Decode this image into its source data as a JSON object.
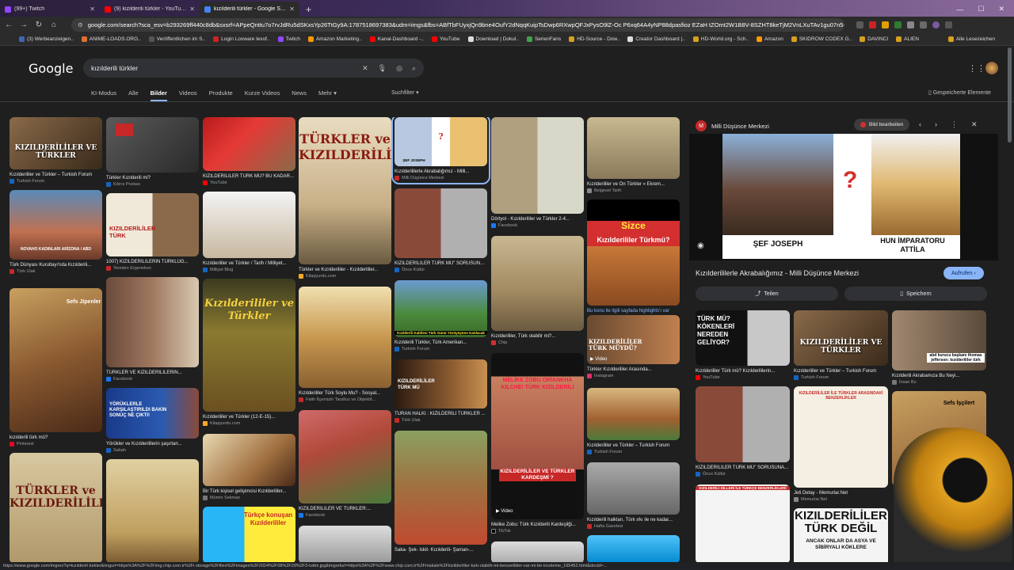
{
  "tabs": [
    {
      "label": "(99+) Twitch",
      "color": "#9146ff"
    },
    {
      "label": "(9) kizilderili türkler - YouTube",
      "color": "#ff0000"
    },
    {
      "label": "kızılderili türkler - Google Suche",
      "color": "#4285f4"
    }
  ],
  "address": {
    "url": "google.com/search?sca_esv=b293269ff440c8db&sxsrf=APpeQnttu7o7rvJdRu5dSKxsYp26TtGy9A:1787518697383&udm=imgs&fbs=ABfTbFUyxjQn9bne4OufY2dNqqKuipTsDwp6RXwpQFJxPysO9lZ-Oc P6xq64A4yNP88dpasfioz EZaH tZOmt2W1B8V-8SZHT8keTjM2VnLXuTAv1gu07n5--r-F3GvcuxgU2wNBbK..."
  },
  "bookmarks": [
    {
      "label": "(3) Werbeanzeigen..",
      "color": "#4267b2"
    },
    {
      "label": "ANIME-LOADS.ORG..",
      "color": "#e07030"
    },
    {
      "label": "Veröffentlichen im S..",
      "color": "#555555"
    },
    {
      "label": "Login Loxware lexof..",
      "color": "#cc2222"
    },
    {
      "label": "Twitch",
      "color": "#9146ff"
    },
    {
      "label": "Amazon Marketing..",
      "color": "#ff9900"
    },
    {
      "label": "Kanal-Dashboard -..",
      "color": "#ff0000"
    },
    {
      "label": "YouTube",
      "color": "#ff0000"
    },
    {
      "label": "Download | Dokul..",
      "color": "#dddddd"
    },
    {
      "label": "SerienFans",
      "color": "#3fa34d"
    },
    {
      "label": "HD-Source - Dow..",
      "color": "#d8a020"
    },
    {
      "label": "Creator Dashboard |..",
      "color": "#dddddd"
    },
    {
      "label": "HD-World.org - Sch..",
      "color": "#d8a020"
    },
    {
      "label": "Amazon",
      "color": "#ff9900"
    },
    {
      "label": "SKIDROW CODEX G..",
      "color": "#d8a020"
    },
    {
      "label": "DAVINCI",
      "color": "#d8a020"
    },
    {
      "label": "ALIEN",
      "color": "#d8a020"
    }
  ],
  "all_bookmarks": "Alle Lesezeichen",
  "google": {
    "logo": "Google",
    "query": "kızılderili türkler",
    "tabs": [
      "KI-Modus",
      "Alle",
      "Bilder",
      "Videos",
      "Produkte",
      "Kurze Videos",
      "News",
      "Mehr ▾"
    ],
    "active_tab": "Bilder",
    "tools": "Suchfilter ▾",
    "saved": "Gespeicherte Elemente"
  },
  "results": {
    "col1": [
      {
        "caption": "Kızılderililer ve Türkler – Turkish Forum",
        "source": "Turkish Forum",
        "overlay": "KIZILDERİLİLER VE TÜRKLER"
      },
      {
        "caption": "Türk Dünyası Kurultayı'nda Kızılderili...",
        "source": "Türk Ulak",
        "overlay": "NOVAHO KADINLARI ARİZONA / ABD"
      },
      {
        "caption": "kızılderili türk mü?",
        "source": "Pinterest",
        "overlay": "Sefs Jipenler"
      },
      {
        "caption": "",
        "source": "",
        "overlay": "TÜRKLER ve KIZILDERİLİLER"
      }
    ],
    "col2": [
      {
        "caption": "Türkler Kızılderili mi?",
        "source": "Kıbrıs Postası"
      },
      {
        "caption": "1007) KIZILDERİLİLERİN TÜRKLÜĞ...",
        "source": "Yeniden Ergenekon",
        "overlay": "KIZILDERİLİLER TÜRK"
      },
      {
        "caption": "TÜRKLER VE KIZILDERİLİLERİN...",
        "source": "Facebook"
      },
      {
        "caption": "Yörükler ve Kızılderililerin şaşırtan...",
        "source": "Sabah",
        "overlay": "YÖRÜKLERLE KARŞILAŞTIRILDI BAKIN SONUÇ NE ÇIKTI!"
      },
      {
        "caption": "",
        "source": ""
      }
    ],
    "col3": [
      {
        "caption": "KIZILDERİLİLER TÜRK MÜ? BU KADAR...",
        "source": "YouTube"
      },
      {
        "caption": "Kızılderililer ve Türkler / Tarih / Milliyet...",
        "source": "Milliyet Blog"
      },
      {
        "caption": "Kızılderililer ve Türkler (12-E-15)...",
        "source": "Kitapyurdu.com",
        "overlay": "Kızılderililer ve Türkler"
      },
      {
        "caption": "Bir Türk kişisel gelişimcisi Kızılderililer...",
        "source": "Mümin Sekman"
      },
      {
        "caption": "",
        "source": "",
        "overlay": "Türkçe konuşan Kızılderililer"
      }
    ],
    "col4": [
      {
        "caption": "Türkler ve Kızılderililer - Kızılderililer...",
        "source": "Kitapyurdu.com",
        "overlay": "TÜRKLER ve KIZILDERİLİLER"
      },
      {
        "caption": "Kızılderililer Türk Soylu Mu? - Sosyal...",
        "source": "Fatih İlçemizin Tarafsız ve Objektif..."
      },
      {
        "caption": "KIZILDERİLİLER VE TÜRKLER:...",
        "source": "Facebook"
      },
      {
        "caption": "",
        "source": ""
      }
    ],
    "col5": [
      {
        "caption": "Kızılderililerle Akrabalığımız - Milli...",
        "source": "Milli Düşünce Merkezi",
        "overlay": "ŞEF JOSEPH"
      },
      {
        "caption": "KIZILDERİLİLER TÜRK MÜ\" SORUSUNA...",
        "source": "Önce Kültür"
      },
      {
        "caption": "Kızılderili Türkler, Türk Amerikan...",
        "source": "Turkish Forum",
        "overlay": "Kızılderili Kabilesi Türk Günü Yürüyüşüne Katılacak"
      },
      {
        "caption": "TURAN HALKI : KIZILDERİLİ TÜRKLER ...",
        "source": "Türk Ulak",
        "overlay": "KIZILDERİLİLER TÜRK MÜ"
      },
      {
        "caption": "Saka- Şek- Iskit- Kızılderili- Şaman-...",
        "source": ""
      }
    ],
    "col6": [
      {
        "caption": "Dörtyol - Kızılderililer ve Türkler 2-4...",
        "source": "Facebook"
      },
      {
        "caption": "Kızılderililer, Türk olabilir mi?...",
        "source": "Chip"
      },
      {
        "caption": "Melike Zobu: Türk Kızılderili Kardeşliği...",
        "source": "TikTok",
        "overlay": "MELİKE ZOBU ORİANKHA KILCHE! TÜRK KIZILDERİLİ",
        "overlay2": "KIZILDERİLİLER VE TÜRKLER KARDEŞMİ ?",
        "badge": "▶ Video"
      }
    ],
    "col7": [
      {
        "caption": "Kızılderililer ve Ön Türkler » Ekrem...",
        "source": "Belgesel Tarih"
      },
      {
        "caption": "Sizce Kızılderililer Türkmü?",
        "source": "",
        "overlay": "Sizce",
        "overlay2": "Kızılderililer Türkmü?"
      },
      {
        "caption": "Bu konu ile ilgili sayfada highlights'ı var",
        "source": "",
        "overlay": "KIZILDERİLİLER TÜRK MÜYDÜ?"
      },
      {
        "caption": "Türkler Kızılderililer Arasında...",
        "source": "Instagram",
        "badge": "▶ Video"
      },
      {
        "caption": "Kızılderililer ve Türkler – Turkish Forum",
        "source": "Turkish Forum"
      },
      {
        "caption": "Kızılderili halkları, Türk ırkı ile ne kadar...",
        "source": "Hafta Gazetesi"
      }
    ]
  },
  "panel": {
    "site": "Milli Düşünce Merkezi",
    "edit": "Bild bearbeiten",
    "image_labels": {
      "left": "ŞEF JOSEPH",
      "right_line1": "HUN İMPARATORU",
      "right_line2": "ATTİLA",
      "mark": "?"
    },
    "title": "Kızılderililerle Akrabalığımız - Milli Düşünce Merkezi",
    "visit": "Aufrufen ›",
    "share": "Teilen",
    "save": "Speichern",
    "related": [
      {
        "caption": "Kızılderililer Türk mü? Kızılderililerin...",
        "source": "YouTube",
        "overlay": "TÜRK MÜ? KÖKENLERİ NEREDEN GELİYOR?"
      },
      {
        "caption": "Kızılderililer ve Türkler – Turkish Forum",
        "source": "Turkish Forum",
        "overlay": "KIZILDERİLİLER VE TÜRKLER"
      },
      {
        "caption": "Kızılderili Akrabamıza Bu Neyi...",
        "source": "İnsan Bu",
        "overlay": "abd kurucu başkanı thomas jefferson: kızılderililer türk"
      },
      {
        "caption": "KIZILDERİLİLER TÜRK MÜ\" SORUSUNA...",
        "source": "Önce Kültür"
      },
      {
        "caption": "Jeti Detay - Memurlar.Net",
        "source": "Memurlar.Net",
        "overlay": "KIZILDERİLİLER İLE TÜRKLER ARASINDAKİ BENZERLİKLER"
      },
      {
        "caption": "",
        "source": "",
        "overlay": "Sefs İşçilert"
      },
      {
        "caption": "",
        "source": "",
        "overlay": "KIZILDERİLİ DİLLERİ İLE TÜRKÇE BENZERLİKLERİ"
      },
      {
        "caption": "",
        "source": "",
        "overlay": "KIZILDERİLİLER TÜRK DEĞİL",
        "overlay2": "ANCAK ONLAR DA ASYA VE SİBİRYALI KÖKLERE"
      }
    ]
  },
  "status": "https://www.google.com/imgres?q=kızılderili türkler&imgurl=https%3A%2F%2Fimg.chip.com.tr%2Fi storage%2Ffiles%2Fimages%2F2024%2F08%2F29%2F3-tuttm.jpg&imgrefurl=https%3A%2F%2Fwww.chip.com.tr%2Fmakale%2Fkizilderililer-turk-olabilir-mi-benzerlikler-var-mi-bir-inceleme_165452.html&docid=...",
  "colors": {
    "accent": "#8ab4f8",
    "bg": "#1f1f1f",
    "surface": "#303134"
  }
}
